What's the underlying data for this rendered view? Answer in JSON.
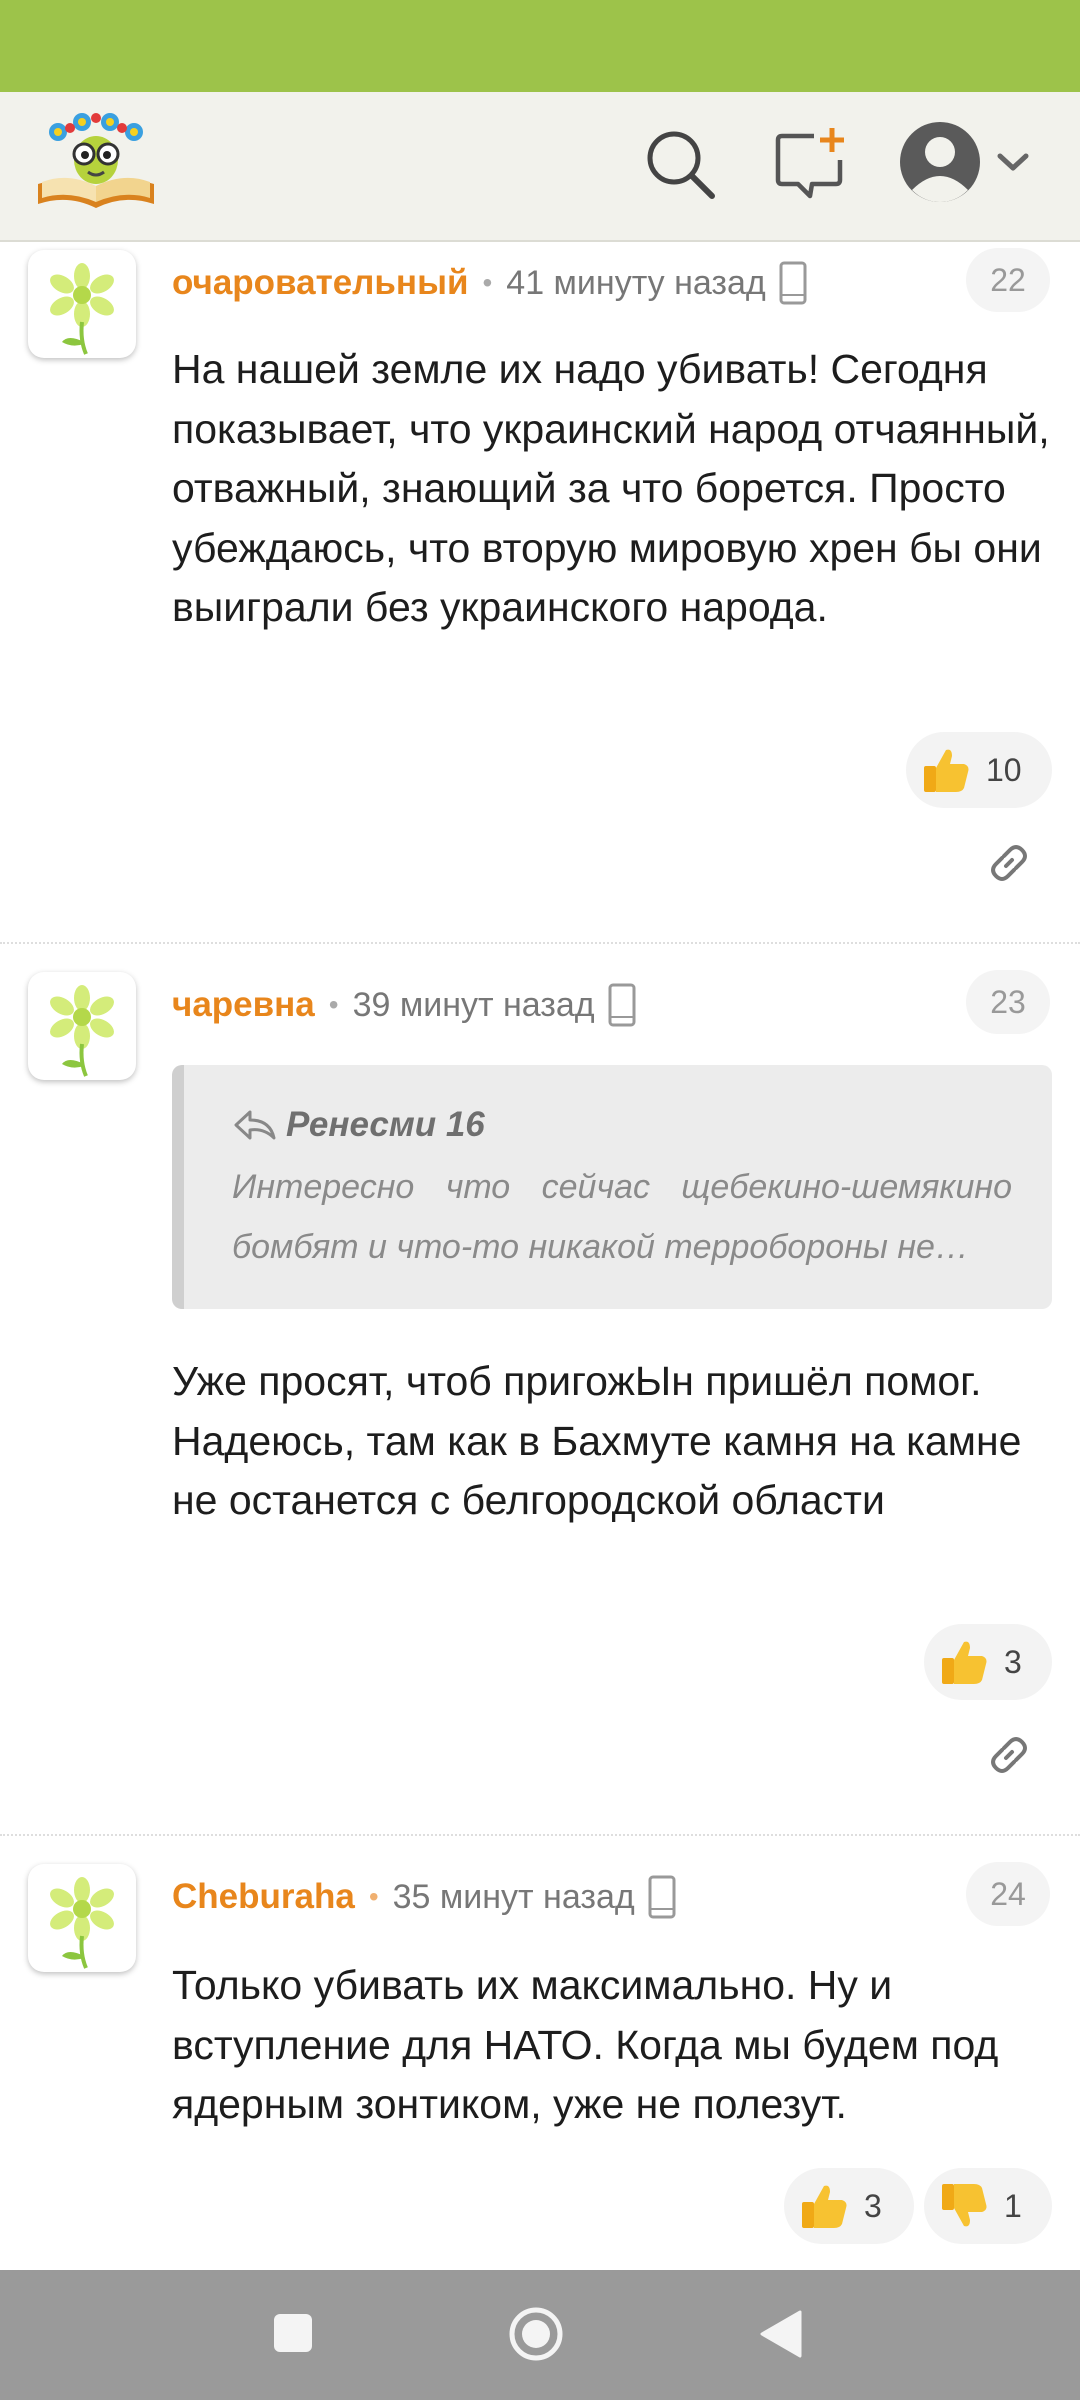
{
  "comments": [
    {
      "username": "очаровательный",
      "time": "41 минуту назад",
      "number": "22",
      "text": "На нашей земле их надо убивать! Сегодня показывает, что украинский народ отчаянный, отважный, знающий за что борется. Просто убеждаюсь, что вторую мировую хрен бы они выиграли без украинского народа.",
      "likes": "10"
    },
    {
      "username": "чаревна",
      "time": "39 минут назад",
      "number": "23",
      "quote_author": "Ренесми 16",
      "quote_text": "Интересно что сейчас щебекино-шемякино бомбят и что-то никакой терробороны не…",
      "text": "Уже просят, чтоб пригожЫн пришёл помог. Надеюсь, там как в Бахмуте камня на камне не останется с белгородской области",
      "likes": "3"
    },
    {
      "username": "Cheburaha",
      "time": "35 минут назад",
      "number": "24",
      "text": "Только убивать их максимально. Ну и вступление для НАТО. Когда мы будем под ядерным зонтиком, уже не полезут.",
      "likes": "3",
      "dislikes": "1"
    }
  ],
  "colors": {
    "status_bar": "#9dc34a",
    "username": "#e8861c",
    "header_bg": "#f2f2ec",
    "nav_bar": "#9a9a9a"
  },
  "icons": [
    "search-icon",
    "new-message-icon",
    "user-avatar-icon",
    "chevron-down-icon",
    "phone-icon",
    "thumbs-up-icon",
    "thumbs-down-icon",
    "link-icon",
    "reply-arrow-icon",
    "nav-recent-icon",
    "nav-home-icon",
    "nav-back-icon"
  ]
}
